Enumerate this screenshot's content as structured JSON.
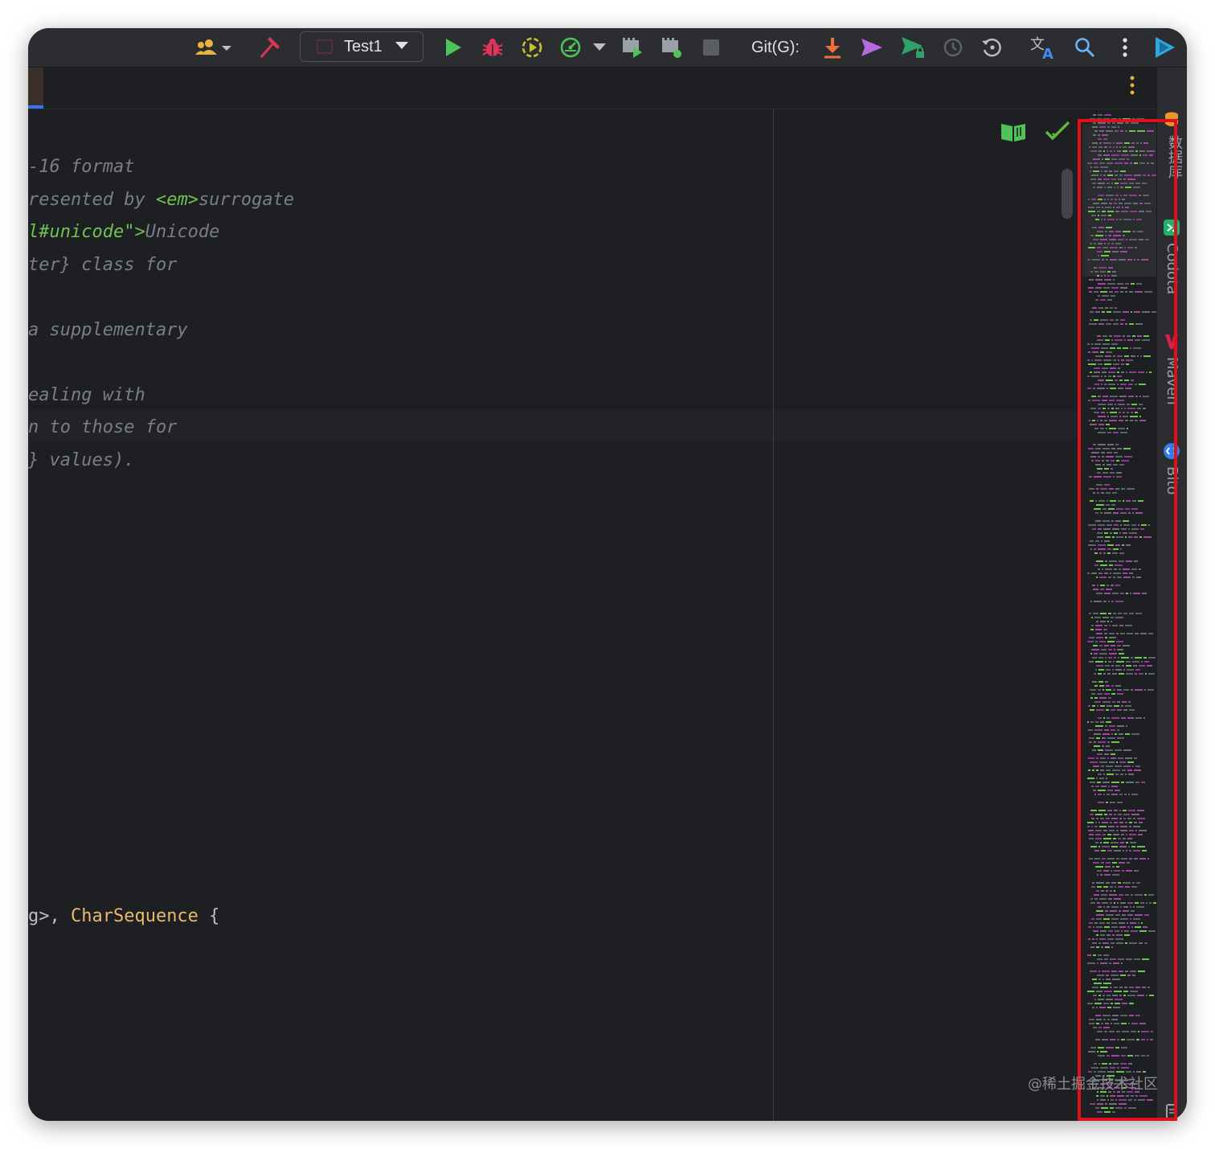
{
  "toolbar": {
    "run_config": "Test1",
    "git_label": "Git(G):"
  },
  "editor": {
    "lines": [
      {
        "segments": [
          {
            "text": "-16 format",
            "style": "comment"
          }
        ]
      },
      {
        "segments": [
          {
            "text": "resented by ",
            "style": "comment"
          },
          {
            "text": "<em>",
            "style": "tag"
          },
          {
            "text": "surrogate",
            "style": "comment"
          }
        ]
      },
      {
        "segments": [
          {
            "text": "l#unicode\">",
            "style": "tag"
          },
          {
            "text": "Unicode",
            "style": "comment"
          }
        ]
      },
      {
        "segments": [
          {
            "text": "ter} class for",
            "style": "comment"
          }
        ]
      },
      {
        "segments": [
          {
            "text": "a supplementary",
            "style": "comment"
          }
        ]
      },
      {
        "segments": [
          {
            "text": "ealing with",
            "style": "comment"
          }
        ]
      },
      {
        "segments": [
          {
            "text": "n to those for",
            "style": "comment"
          }
        ]
      },
      {
        "segments": [
          {
            "text": "} values).",
            "style": "comment"
          }
        ]
      },
      {
        "segments": [
          {
            "text": "g>, ",
            "style": "plain"
          },
          {
            "text": "CharSequence",
            "style": "cls"
          },
          {
            "text": " {",
            "style": "plain"
          }
        ]
      }
    ]
  },
  "right_sidebar": {
    "labels": [
      "数据库",
      "Codota",
      "Maven",
      "Bito"
    ]
  },
  "watermark": "@稀土掘金技术社区",
  "colors": {
    "background": "#1e1f22",
    "toolbar": "#2b2d30",
    "comment": "#7a7e85",
    "tag": "#6ec44e",
    "class_name": "#e8ba6b",
    "highlight_box": "#e0101a"
  }
}
